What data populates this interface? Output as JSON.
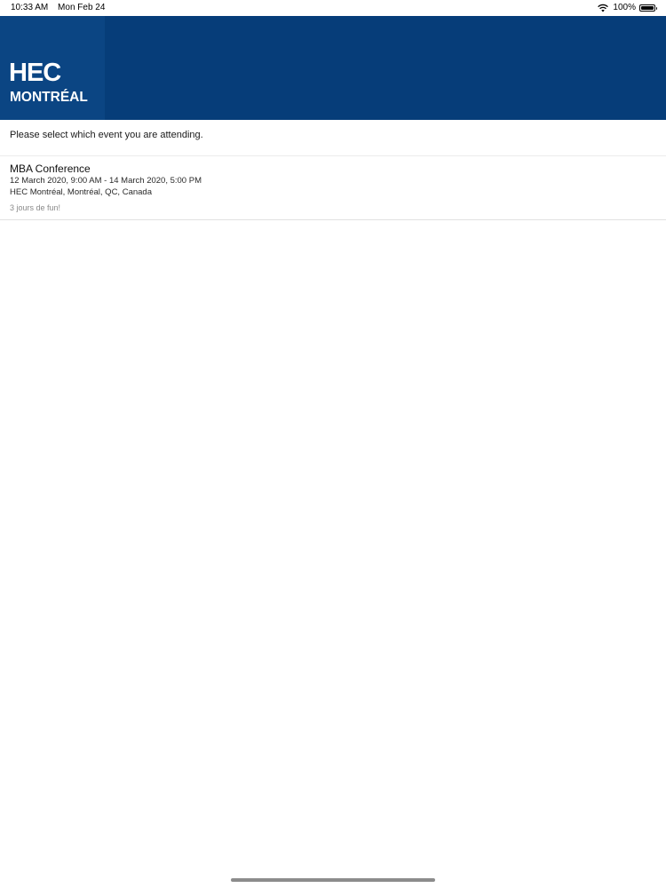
{
  "status_bar": {
    "time": "10:33 AM",
    "date": "Mon Feb 24",
    "battery": "100%",
    "icons": [
      "wifi-icon",
      "battery-icon"
    ]
  },
  "header": {
    "background_color": "#063d79",
    "logo_block_color": "#0b4583",
    "logo_line1": "HEC",
    "logo_line2": "MONTRÉAL"
  },
  "instruction": "Please select which event you are attending.",
  "events": [
    {
      "title": "MBA Conference",
      "dates": "12 March 2020,  9:00 AM - 14 March 2020,  5:00 PM",
      "location": "HEC Montréal, Montréal, QC, Canada",
      "description": "3 jours de fun!"
    }
  ]
}
